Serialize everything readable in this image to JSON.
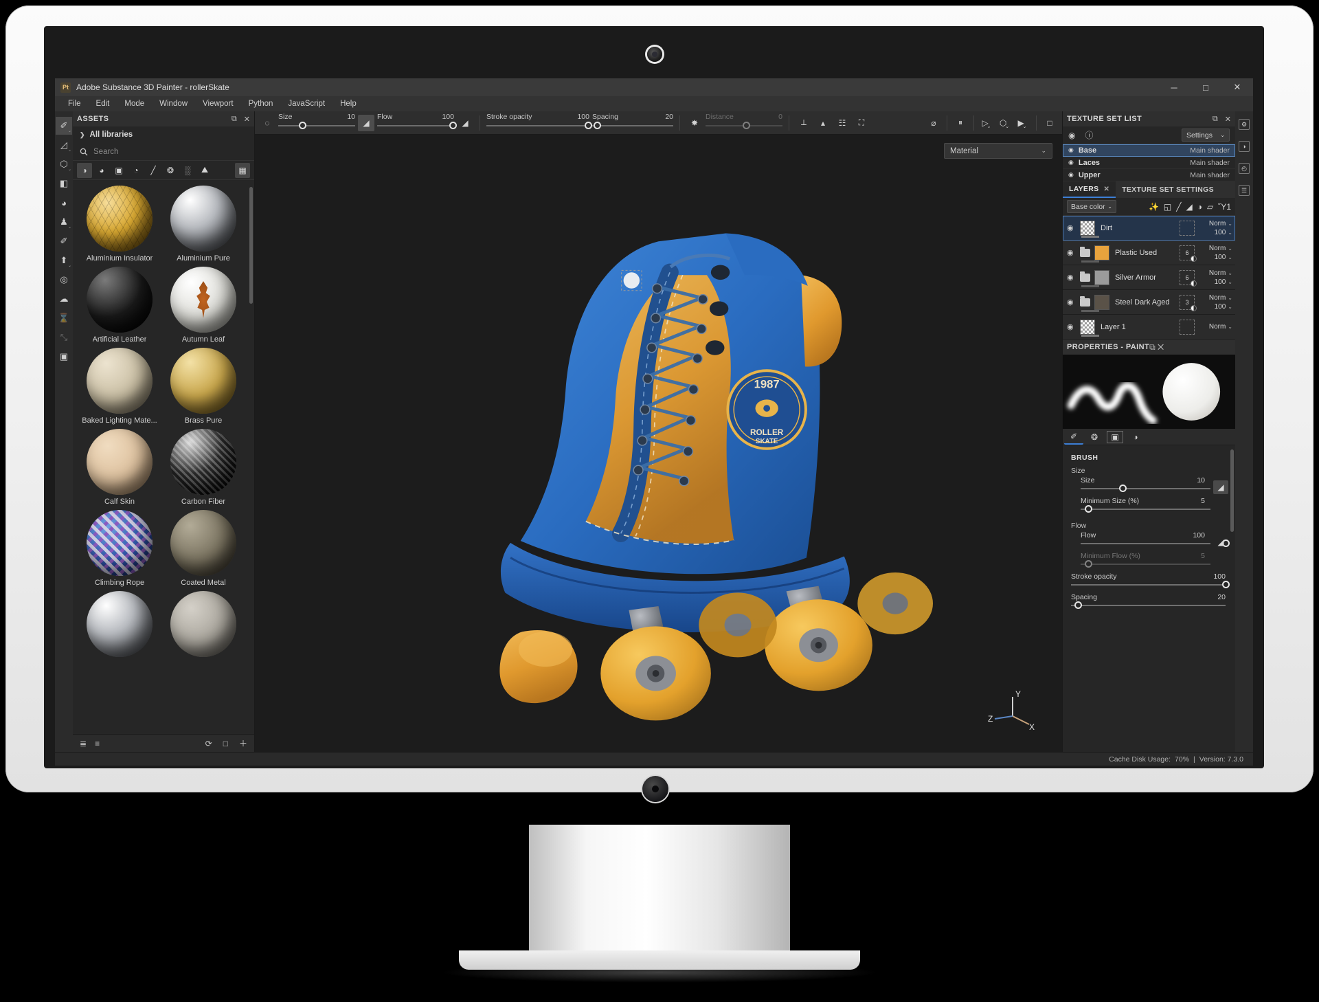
{
  "window": {
    "app_badge": "Pt",
    "title": "Adobe Substance 3D Painter - rollerSkate",
    "minimize": "─",
    "maximize": "□",
    "close": "✕"
  },
  "menubar": {
    "items": [
      "File",
      "Edit",
      "Mode",
      "Window",
      "Viewport",
      "Python",
      "JavaScript",
      "Help"
    ]
  },
  "left_toolbar": {
    "tools": [
      {
        "name": "paint-tool",
        "glyph": "✐",
        "active": true,
        "caret": true
      },
      {
        "name": "eraser-tool",
        "glyph": "◿",
        "active": false,
        "caret": true
      },
      {
        "name": "projection-tool",
        "glyph": "⬡",
        "active": false,
        "caret": true
      },
      {
        "name": "geometry-fill-tool",
        "glyph": "◧",
        "active": false,
        "caret": false
      },
      {
        "name": "smudge-tool",
        "glyph": "◕",
        "active": false,
        "caret": false
      },
      {
        "name": "clone-tool",
        "glyph": "♟",
        "active": false,
        "caret": true
      },
      {
        "name": "eyedropper-tool",
        "glyph": "✐",
        "active": false,
        "caret": false
      },
      {
        "name": "export-tool",
        "glyph": "⬆",
        "active": false,
        "caret": true
      },
      {
        "name": "particles-tool",
        "glyph": "◎",
        "active": false,
        "caret": false
      },
      {
        "name": "physical-paint-tool",
        "glyph": "☁",
        "active": false,
        "caret": false
      },
      {
        "name": "bake-tool",
        "glyph": "⌛",
        "active": false,
        "caret": false,
        "dim": true
      },
      {
        "name": "transform-tool",
        "glyph": "⤡",
        "active": false,
        "caret": false,
        "dim": true
      },
      {
        "name": "baking-tool",
        "glyph": "▣",
        "active": false,
        "caret": false
      }
    ]
  },
  "assets": {
    "title": "ASSETS",
    "dock_icon": "⧉",
    "close_icon": "✕",
    "library_label": "All libraries",
    "library_chevron": "❯",
    "search_icon": "search-icon",
    "search_placeholder": "Search",
    "search_value": "",
    "filters": [
      {
        "name": "filter-all",
        "glyph": "◑",
        "active": true
      },
      {
        "name": "filter-materials",
        "glyph": "◕",
        "active": false
      },
      {
        "name": "filter-smart-materials",
        "glyph": "▣",
        "active": false
      },
      {
        "name": "filter-masks",
        "glyph": "◔",
        "active": false
      },
      {
        "name": "filter-brushes",
        "glyph": "╱",
        "active": false
      },
      {
        "name": "filter-alphas",
        "glyph": "❂",
        "active": false
      },
      {
        "name": "filter-textures",
        "glyph": "░",
        "active": false
      },
      {
        "name": "filter-environments",
        "glyph": "⛰",
        "active": false
      }
    ],
    "grid_toggle": "▦",
    "materials": [
      {
        "label": "Aluminium Insulator",
        "swatch": "gold-tri"
      },
      {
        "label": "Aluminium Pure",
        "swatch": "chrome"
      },
      {
        "label": "Artificial Leather",
        "swatch": "black-gloss"
      },
      {
        "label": "Autumn Leaf",
        "swatch": "leaf"
      },
      {
        "label": "Baked Lighting Mate...",
        "swatch": "beige"
      },
      {
        "label": "Brass Pure",
        "swatch": "brass"
      },
      {
        "label": "Calf Skin",
        "swatch": "skin"
      },
      {
        "label": "Carbon Fiber",
        "swatch": "carbon"
      },
      {
        "label": "Climbing Rope",
        "swatch": "rope"
      },
      {
        "label": "Coated Metal",
        "swatch": "coated"
      },
      {
        "label": "",
        "swatch": "chrome"
      },
      {
        "label": "",
        "swatch": "concrete"
      }
    ],
    "footer": {
      "list_view_icon": "≣",
      "detail_view_icon": "≡",
      "refresh_icon": "⟳",
      "folder_icon": "□",
      "add_icon": "＋"
    }
  },
  "brush_toolbar": {
    "brush_preset_icon": "◌",
    "brush_preset_caret": "⌄",
    "size": {
      "label": "Size",
      "value": "10",
      "pct": 28
    },
    "size_pressure_icon": "pressure-icon",
    "flow": {
      "label": "Flow",
      "value": "100",
      "pct": 100
    },
    "flow_pressure_icon": "pressure-icon",
    "stroke_opacity": {
      "label": "Stroke opacity",
      "value": "100",
      "pct": 100
    },
    "spacing": {
      "label": "Spacing",
      "value": "20",
      "pct": 4
    },
    "scatter_icon": "scatter-icon",
    "distance": {
      "label": "Distance",
      "value": "0",
      "pct": 50,
      "disabled": true
    },
    "right_tools": [
      {
        "name": "symmetry-icon",
        "glyph": "⟂"
      },
      {
        "name": "mirror-icon",
        "glyph": "▲"
      },
      {
        "name": "tiling-icon",
        "glyph": "⌗"
      },
      {
        "name": "fit-icon",
        "glyph": "⛶"
      }
    ],
    "view_tools": [
      {
        "name": "toggle-uv-preview-icon",
        "glyph": "⌀"
      },
      {
        "name": "pause-render-icon",
        "glyph": "⏸"
      },
      {
        "name": "perspective-camera-icon",
        "glyph": "▷",
        "caret": true
      },
      {
        "name": "material-mode-icon",
        "glyph": "⬡",
        "caret": true
      },
      {
        "name": "camera-bookmark-icon",
        "glyph": "▶",
        "caret": true
      },
      {
        "name": "screenshot-icon",
        "glyph": "□"
      }
    ]
  },
  "viewport": {
    "shader_dropdown": {
      "value": "Material",
      "caret": "⌄"
    },
    "axis": {
      "x": "X",
      "y": "Y",
      "z": "Z"
    }
  },
  "texture_set_list": {
    "title": "TEXTURE SET LIST",
    "dock_icon": "⧉",
    "close_icon": "✕",
    "toolbar": [
      {
        "name": "toggle-visibility-all-icon",
        "glyph": "◉"
      },
      {
        "name": "texture-set-info-icon",
        "glyph": "ⓘ"
      }
    ],
    "settings_dropdown": {
      "label": "Settings",
      "caret": "⌄"
    },
    "sets": [
      {
        "name": "Base",
        "shader": "Main shader",
        "selected": true,
        "eye": "◉"
      },
      {
        "name": "Laces",
        "shader": "Main shader",
        "selected": false,
        "eye": "◉"
      },
      {
        "name": "Upper",
        "shader": "Main shader",
        "selected": false,
        "eye": "◉"
      }
    ]
  },
  "layers_panel": {
    "tabs": [
      {
        "label": "LAYERS",
        "active": true,
        "closable": true,
        "close_icon": "✕"
      },
      {
        "label": "TEXTURE SET SETTINGS",
        "active": false,
        "closable": false
      }
    ],
    "channel_dropdown": {
      "value": "Base color",
      "caret": "⌄"
    },
    "tools": [
      {
        "name": "add-effect-icon",
        "glyph": "✨"
      },
      {
        "name": "add-fill-layer-icon",
        "glyph": "◱"
      },
      {
        "name": "add-paint-layer-icon",
        "glyph": "╱"
      },
      {
        "name": "add-mask-icon",
        "glyph": "◢"
      },
      {
        "name": "add-smart-mask-icon",
        "glyph": "◑"
      },
      {
        "name": "add-folder-icon",
        "glyph": "▱"
      },
      {
        "name": "delete-layer-icon",
        "glyph": "Ὕ1"
      }
    ],
    "layers": [
      {
        "name": "Dirt",
        "type": "paint",
        "selected": true,
        "blend": "Norm",
        "opacity": "100",
        "mask_count": "",
        "eye": "◉",
        "swatch": "checker"
      },
      {
        "name": "Plastic Used",
        "type": "folder",
        "selected": false,
        "blend": "Norm",
        "opacity": "100",
        "mask_count": "6",
        "eye": "◉",
        "swatch": "#e8a33d"
      },
      {
        "name": "Silver Armor",
        "type": "folder",
        "selected": false,
        "blend": "Norm",
        "opacity": "100",
        "mask_count": "6",
        "eye": "◉",
        "swatch": "#9b9b9b"
      },
      {
        "name": "Steel Dark Aged",
        "type": "folder",
        "selected": false,
        "blend": "Norm",
        "opacity": "100",
        "mask_count": "3",
        "eye": "◉",
        "swatch": "#5a5248"
      },
      {
        "name": "Layer 1",
        "type": "paint",
        "selected": false,
        "blend": "Norm",
        "opacity": "",
        "mask_count": "",
        "eye": "◉",
        "swatch": "checker"
      }
    ]
  },
  "properties": {
    "title": "PROPERTIES - PAINT",
    "dock_icon": "⧉",
    "close_icon": "✕",
    "preview_tabs": [
      {
        "name": "brush-tab-icon",
        "glyph": "✐",
        "active": true
      },
      {
        "name": "alpha-tab-icon",
        "glyph": "❂",
        "active": false
      },
      {
        "name": "material-tab-icon",
        "glyph": "▣",
        "active": false
      },
      {
        "name": "stencil-tab-icon",
        "glyph": "◑",
        "active": false
      }
    ],
    "section": "BRUSH",
    "groups": [
      {
        "label": "Size",
        "rows": [
          {
            "label": "Size",
            "value": "10",
            "pct": 28,
            "has_pressure": true,
            "pressure_boxed": true,
            "disabled": false
          },
          {
            "label": "Minimum Size (%)",
            "value": "5",
            "pct": 5,
            "has_pressure": false,
            "disabled": false
          }
        ]
      },
      {
        "label": "Flow",
        "rows": [
          {
            "label": "Flow",
            "value": "100",
            "pct": 100,
            "has_pressure": true,
            "pressure_boxed": false,
            "disabled": false
          },
          {
            "label": "Minimum Flow (%)",
            "value": "5",
            "pct": 5,
            "has_pressure": false,
            "disabled": true
          }
        ]
      }
    ],
    "wide_rows": [
      {
        "label": "Stroke opacity",
        "value": "100",
        "pct": 100
      },
      {
        "label": "Spacing",
        "value": "20",
        "pct": 4
      }
    ]
  },
  "right_rail": {
    "buttons": [
      {
        "name": "display-settings-icon",
        "glyph": "⚙"
      },
      {
        "name": "shader-settings-icon",
        "glyph": "◑"
      },
      {
        "name": "history-icon",
        "glyph": "◴"
      },
      {
        "name": "log-icon",
        "glyph": "☰"
      }
    ]
  },
  "statusbar": {
    "cache_label": "Cache Disk Usage:",
    "cache_value": "70%",
    "separator": "|",
    "version_label": "Version: 7.3.0"
  },
  "colors": {
    "accent": "#3d7fd6",
    "skate_blue": "#2f6fc4",
    "skate_yellow": "#e8a63a",
    "panel_bg": "#262626"
  }
}
